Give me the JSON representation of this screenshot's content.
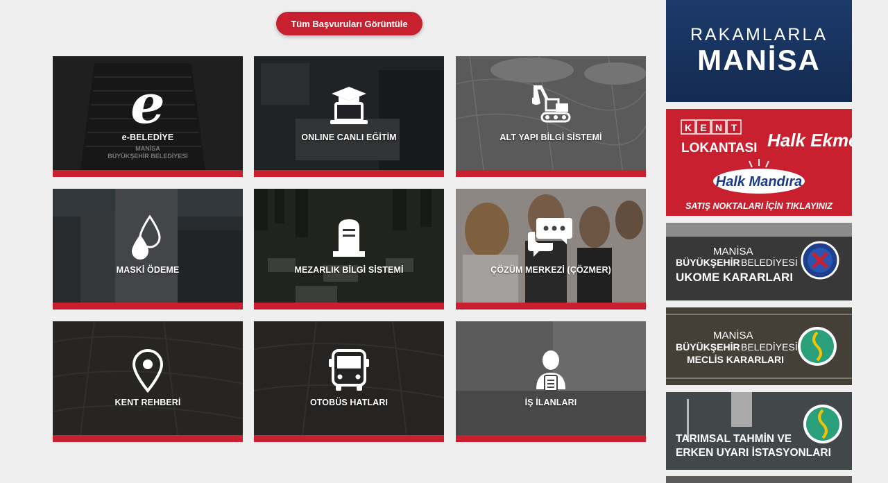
{
  "top_button": "Tüm Başvuruları Görüntüle",
  "tiles": [
    {
      "label": "e-BELEDİYE",
      "icon": "e-letter-icon"
    },
    {
      "label": "ONLINE CANLI EĞİTİM",
      "icon": "graduation-laptop-icon"
    },
    {
      "label": "ALT YAPI BİLGİ SİSTEMİ",
      "icon": "excavator-icon"
    },
    {
      "label": "MASKİ ÖDEME",
      "icon": "water-drops-icon"
    },
    {
      "label": "MEZARLIK BİLGİ SİSTEMİ",
      "icon": "gravestone-icon"
    },
    {
      "label": "ÇÖZÜM MERKEZİ (ÇÖZMER)",
      "icon": "chat-bubbles-icon"
    },
    {
      "label": "KENT REHBERİ",
      "icon": "map-pin-icon"
    },
    {
      "label": "OTOBÜS HATLARI",
      "icon": "bus-icon"
    },
    {
      "label": "İŞ İLANLARI",
      "icon": "job-person-icon"
    }
  ],
  "tile_photo_text": {
    "ebelediye_line1": "MANİSA",
    "ebelediye_line2": "BÜYÜKŞEHİR BELEDİYESİ"
  },
  "banners": {
    "rakamlarla": {
      "line1": "RAKAMLARLA",
      "line2": "MANİSA"
    },
    "kent_lokantasi": {
      "kent": [
        "K",
        "E",
        "N",
        "T"
      ],
      "lokantasi": "LOKANTASI",
      "halk_ekmek": "Halk Ekmek",
      "halk_mandira": "Halk Mandıra",
      "cta": "SATIŞ NOKTALARI İÇİN TIKLAYINIZ"
    },
    "ukome": {
      "line1": "MANİSA",
      "line2a": "BÜYÜKŞEHİR",
      "line2b": "BELEDİYESİ",
      "line3": "UKOME KARARLARI"
    },
    "meclis": {
      "line1": "MANİSA",
      "line2a": "BÜYÜKŞEHİR",
      "line2b": "BELEDİYESİ",
      "line3": "MECLİS KARARLARI"
    },
    "tarimsal": {
      "line1": "TARIMSAL TAHMİN VE",
      "line2": "ERKEN UYARI İSTASYONLARI"
    }
  },
  "colors": {
    "accent": "#c8202e",
    "navy": "#1a3563",
    "bg": "#efefef"
  }
}
